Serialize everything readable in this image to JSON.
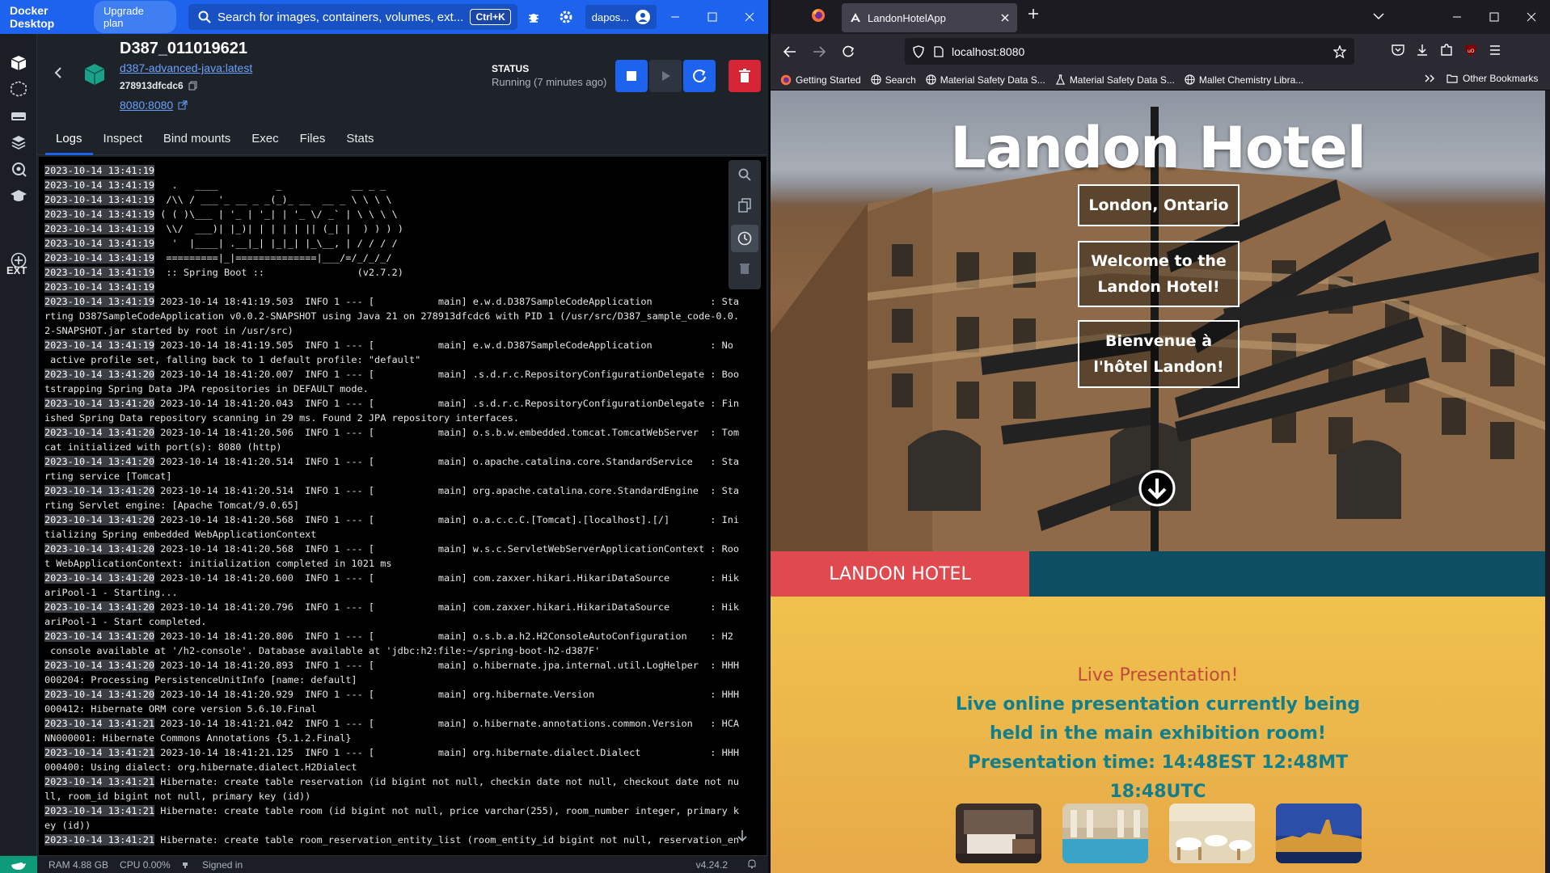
{
  "docker": {
    "brand": "Docker Desktop",
    "upgrade_label": "Upgrade plan",
    "search_placeholder": "Search for images, containers, volumes, ext...",
    "search_shortcut": "Ctrl+K",
    "user": "dapos...",
    "sidebar_ext": "EXT",
    "container": {
      "name": "D387_011019621",
      "image": "d387-advanced-java:latest",
      "id": "278913dfcdc6",
      "port": "8080:8080",
      "status_label": "STATUS",
      "status_value": "Running (7 minutes ago)"
    },
    "tabs": [
      "Logs",
      "Inspect",
      "Bind mounts",
      "Exec",
      "Files",
      "Stats"
    ],
    "active_tab": "Logs",
    "footer": {
      "ram": "RAM 4.88 GB",
      "cpu": "CPU 0.00%",
      "signed": "Signed in",
      "version": "v4.24.2"
    },
    "logs": [
      {
        "ts": "2023-10-14 13:41:19",
        "text": ""
      },
      {
        "ts": "2023-10-14 13:41:19",
        "text": "  .   ____          _            __ _ _"
      },
      {
        "ts": "2023-10-14 13:41:19",
        "text": " /\\\\ / ___'_ __ _ _(_)_ __  __ _ \\ \\ \\ \\"
      },
      {
        "ts": "2023-10-14 13:41:19",
        "text": "( ( )\\___ | '_ | '_| | '_ \\/ _` | \\ \\ \\ \\"
      },
      {
        "ts": "2023-10-14 13:41:19",
        "text": " \\\\/  ___)| |_)| | | | | || (_| |  ) ) ) )"
      },
      {
        "ts": "2023-10-14 13:41:19",
        "text": "  '  |____| .__|_| |_|_| |_\\__, | / / / /"
      },
      {
        "ts": "2023-10-14 13:41:19",
        "text": " =========|_|==============|___/=/_/_/_/"
      },
      {
        "ts": "2023-10-14 13:41:19",
        "text": " :: Spring Boot ::                (v2.7.2)"
      },
      {
        "ts": "2023-10-14 13:41:19",
        "text": ""
      },
      {
        "ts": "2023-10-14 13:41:19",
        "text": "2023-10-14 18:41:19.503  INFO 1 --- [           main] e.w.d.D387SampleCodeApplication          : Sta"
      },
      {
        "ts": "",
        "text": "rting D387SampleCodeApplication v0.0.2-SNAPSHOT using Java 21 on 278913dfcdc6 with PID 1 (/usr/src/D387_sample_code-0.0."
      },
      {
        "ts": "",
        "text": "2-SNAPSHOT.jar started by root in /usr/src)"
      },
      {
        "ts": "2023-10-14 13:41:19",
        "text": "2023-10-14 18:41:19.505  INFO 1 --- [           main] e.w.d.D387SampleCodeApplication          : No"
      },
      {
        "ts": "",
        "text": " active profile set, falling back to 1 default profile: \"default\""
      },
      {
        "ts": "2023-10-14 13:41:20",
        "text": "2023-10-14 18:41:20.007  INFO 1 --- [           main] .s.d.r.c.RepositoryConfigurationDelegate : Boo"
      },
      {
        "ts": "",
        "text": "tstrapping Spring Data JPA repositories in DEFAULT mode."
      },
      {
        "ts": "2023-10-14 13:41:20",
        "text": "2023-10-14 18:41:20.043  INFO 1 --- [           main] .s.d.r.c.RepositoryConfigurationDelegate : Fin"
      },
      {
        "ts": "",
        "text": "ished Spring Data repository scanning in 29 ms. Found 2 JPA repository interfaces."
      },
      {
        "ts": "2023-10-14 13:41:20",
        "text": "2023-10-14 18:41:20.506  INFO 1 --- [           main] o.s.b.w.embedded.tomcat.TomcatWebServer  : Tom"
      },
      {
        "ts": "",
        "text": "cat initialized with port(s): 8080 (http)"
      },
      {
        "ts": "2023-10-14 13:41:20",
        "text": "2023-10-14 18:41:20.514  INFO 1 --- [           main] o.apache.catalina.core.StandardService   : Sta"
      },
      {
        "ts": "",
        "text": "rting service [Tomcat]"
      },
      {
        "ts": "2023-10-14 13:41:20",
        "text": "2023-10-14 18:41:20.514  INFO 1 --- [           main] org.apache.catalina.core.StandardEngine  : Sta"
      },
      {
        "ts": "",
        "text": "rting Servlet engine: [Apache Tomcat/9.0.65]"
      },
      {
        "ts": "2023-10-14 13:41:20",
        "text": "2023-10-14 18:41:20.568  INFO 1 --- [           main] o.a.c.c.C.[Tomcat].[localhost].[/]       : Ini"
      },
      {
        "ts": "",
        "text": "tializing Spring embedded WebApplicationContext"
      },
      {
        "ts": "2023-10-14 13:41:20",
        "text": "2023-10-14 18:41:20.568  INFO 1 --- [           main] w.s.c.ServletWebServerApplicationContext : Roo"
      },
      {
        "ts": "",
        "text": "t WebApplicationContext: initialization completed in 1021 ms"
      },
      {
        "ts": "2023-10-14 13:41:20",
        "text": "2023-10-14 18:41:20.600  INFO 1 --- [           main] com.zaxxer.hikari.HikariDataSource       : Hik"
      },
      {
        "ts": "",
        "text": "ariPool-1 - Starting..."
      },
      {
        "ts": "2023-10-14 13:41:20",
        "text": "2023-10-14 18:41:20.796  INFO 1 --- [           main] com.zaxxer.hikari.HikariDataSource       : Hik"
      },
      {
        "ts": "",
        "text": "ariPool-1 - Start completed."
      },
      {
        "ts": "2023-10-14 13:41:20",
        "text": "2023-10-14 18:41:20.806  INFO 1 --- [           main] o.s.b.a.h2.H2ConsoleAutoConfiguration    : H2"
      },
      {
        "ts": "",
        "text": " console available at '/h2-console'. Database available at 'jdbc:h2:file:~/spring-boot-h2-d387F'"
      },
      {
        "ts": "2023-10-14 13:41:20",
        "text": "2023-10-14 18:41:20.893  INFO 1 --- [           main] o.hibernate.jpa.internal.util.LogHelper  : HHH"
      },
      {
        "ts": "",
        "text": "000204: Processing PersistenceUnitInfo [name: default]"
      },
      {
        "ts": "2023-10-14 13:41:20",
        "text": "2023-10-14 18:41:20.929  INFO 1 --- [           main] org.hibernate.Version                    : HHH"
      },
      {
        "ts": "",
        "text": "000412: Hibernate ORM core version 5.6.10.Final"
      },
      {
        "ts": "2023-10-14 13:41:21",
        "text": "2023-10-14 18:41:21.042  INFO 1 --- [           main] o.hibernate.annotations.common.Version   : HCA"
      },
      {
        "ts": "",
        "text": "NN000001: Hibernate Commons Annotations {5.1.2.Final}"
      },
      {
        "ts": "2023-10-14 13:41:21",
        "text": "2023-10-14 18:41:21.125  INFO 1 --- [           main] org.hibernate.dialect.Dialect            : HHH"
      },
      {
        "ts": "",
        "text": "000400: Using dialect: org.hibernate.dialect.H2Dialect"
      },
      {
        "ts": "2023-10-14 13:41:21",
        "text": "Hibernate: create table reservation (id bigint not null, checkin date not null, checkout date not nu"
      },
      {
        "ts": "",
        "text": "ll, room_id bigint not null, primary key (id))"
      },
      {
        "ts": "2023-10-14 13:41:21",
        "text": "Hibernate: create table room (id bigint not null, price varchar(255), room_number integer, primary k"
      },
      {
        "ts": "",
        "text": "ey (id))"
      },
      {
        "ts": "2023-10-14 13:41:21",
        "text": "Hibernate: create table room_reservation_entity_list (room_entity_id bigint not null, reservation_en"
      }
    ]
  },
  "browser": {
    "tab_title": "LandonHotelApp",
    "url": "localhost:8080",
    "bookmarks": [
      "Getting Started",
      "Search",
      "Material Safety Data S...",
      "Material Safety Data S...",
      "Mallet Chemistry Libra..."
    ],
    "other_bookmarks": "Other Bookmarks",
    "page": {
      "title": "Landon Hotel",
      "location": "London, Ontario",
      "welcome_en": "Welcome to the Landon Hotel!",
      "welcome_fr": "Bienvenue à l'hôtel Landon!",
      "bar_label": "LANDON HOTEL",
      "live_heading": "Live Presentation!",
      "live_body": "Live online presentation currently being held in the main exhibition room! Presentation time: 14:48EST 12:48MT 18:48UTC"
    }
  },
  "colors": {
    "docker_blue": "#1d63ed",
    "hotel_red": "#e04a4f",
    "hotel_teal": "#0e4e63",
    "live_red": "#c24a3a",
    "live_teal": "#0f7f8e"
  }
}
